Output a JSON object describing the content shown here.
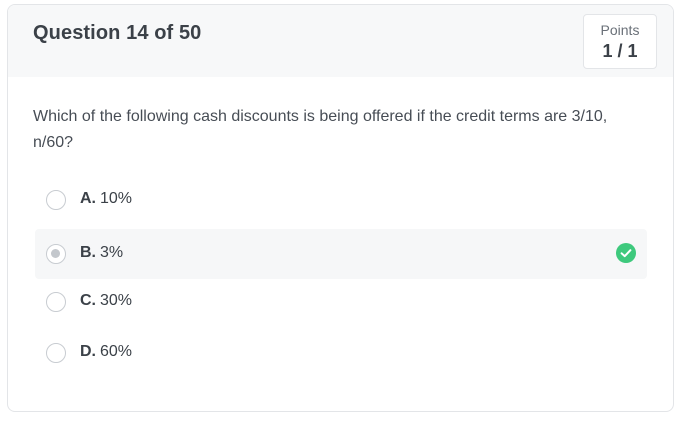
{
  "question": {
    "title": "Question 14 of 50",
    "text": "Which of the following cash discounts is being offered if the credit terms are 3/10, n/60?"
  },
  "points": {
    "label": "Points",
    "value": "1 / 1"
  },
  "options": [
    {
      "letter": "A.",
      "text": "10%",
      "selected": false
    },
    {
      "letter": "B.",
      "text": "3%",
      "selected": true,
      "correct": true
    },
    {
      "letter": "C.",
      "text": "30%",
      "selected": false
    },
    {
      "letter": "D.",
      "text": "60%",
      "selected": false
    }
  ],
  "colors": {
    "correct": "#3ec97d",
    "header_bg": "#f7f8f9",
    "selected_bg": "#f6f7f8"
  },
  "icons": {
    "correct": "check-circle-icon"
  }
}
